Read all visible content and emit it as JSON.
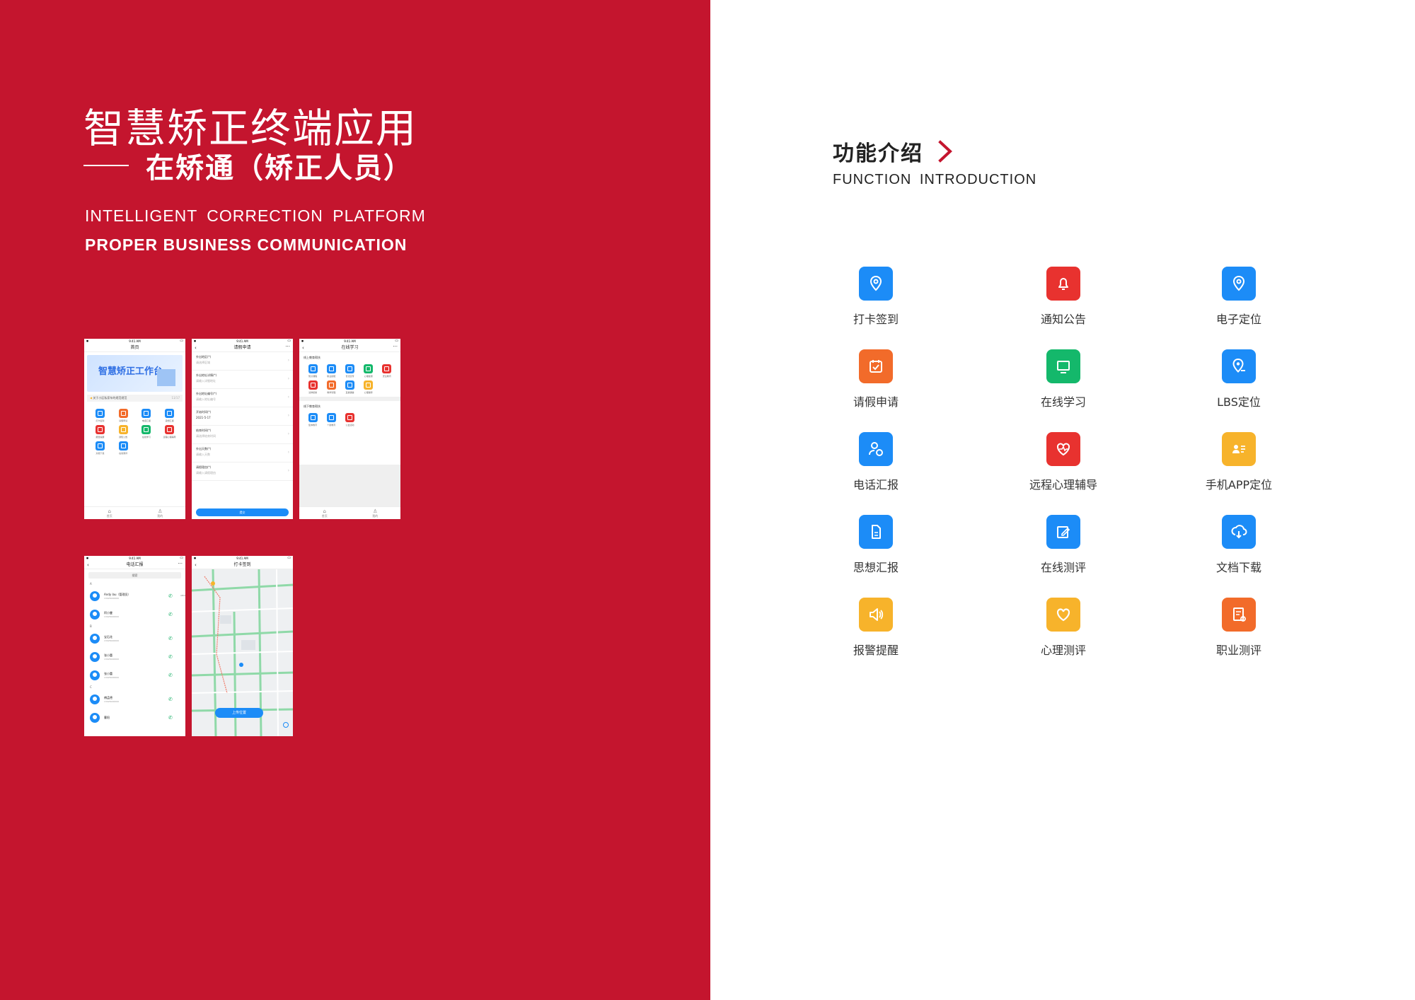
{
  "header": {
    "title_cn": "智慧矫正终端应用",
    "subtitle_cn": "在矫通（矫正人员）",
    "title_en": "INTELLIGENT  CORRECTION  PLATFORM",
    "subtitle_en": "PROPER BUSINESS COMMUNICATION"
  },
  "colors": {
    "brand_red": "#c4152e",
    "blue": "#1c8cf7",
    "red": "#e8322f",
    "orange": "#f26b2a",
    "green": "#14b86b",
    "yellow": "#f7b32b"
  },
  "phones": {
    "home": {
      "status_time": "9:41 AM",
      "title": "首页",
      "banner_text": "智慧矫正工作台",
      "notice": "关于小区私家车的规范规范",
      "notice_date": "11/17",
      "grid": [
        {
          "label": "打卡签到",
          "color": "#1c8cf7"
        },
        {
          "label": "请假申请",
          "color": "#f26b2a"
        },
        {
          "label": "电话汇报",
          "color": "#1c8cf7"
        },
        {
          "label": "思想汇报",
          "color": "#1c8cf7"
        },
        {
          "label": "报警提醒",
          "color": "#e8322f"
        },
        {
          "label": "通知公告",
          "color": "#f7b32b"
        },
        {
          "label": "在线学习",
          "color": "#14b86b"
        },
        {
          "label": "远程心理辅导",
          "color": "#e8322f"
        },
        {
          "label": "文档下载",
          "color": "#1c8cf7"
        },
        {
          "label": "在线测评",
          "color": "#1c8cf7"
        }
      ],
      "tabs": [
        "首页",
        "我的"
      ]
    },
    "leave": {
      "status_time": "9:41 AM",
      "title": "请假申请",
      "fields": [
        {
          "label": "外出地区(*)",
          "value": "请选择区域"
        },
        {
          "label": "外出地址详情(*)",
          "value": "请输入详细地址"
        },
        {
          "label": "外出地址编号(*)",
          "value": "请输入地址编号"
        },
        {
          "label": "开始时间(*)",
          "value": "2021-5-17"
        },
        {
          "label": "结束时间(*)",
          "value": "请选择结束时间"
        },
        {
          "label": "外出天数(*)",
          "value": "请输入天数"
        },
        {
          "label": "请假理由(*)",
          "value": "请输入请假理由"
        }
      ],
      "submit": "提交"
    },
    "study": {
      "status_time": "9:41 AM",
      "title": "在线学习",
      "online_section": "线上教育帮扶",
      "online_items": [
        {
          "label": "知识课程",
          "color": "#1c8cf7"
        },
        {
          "label": "职业技能",
          "color": "#1c8cf7"
        },
        {
          "label": "普法宣传",
          "color": "#1c8cf7"
        },
        {
          "label": "心理健康",
          "color": "#14b86b"
        },
        {
          "label": "安全教育",
          "color": "#e8322f"
        },
        {
          "label": "法律援助",
          "color": "#e8322f"
        },
        {
          "label": "教学管理",
          "color": "#f26b2a"
        },
        {
          "label": "直播课堂",
          "color": "#1c8cf7"
        },
        {
          "label": "心理辅导",
          "color": "#f7b32b"
        }
      ],
      "offline_section": "线下教育帮扶",
      "offline_items": [
        {
          "label": "集体教育",
          "color": "#1c8cf7"
        },
        {
          "label": "个别教育",
          "color": "#1c8cf7"
        },
        {
          "label": "公益活动",
          "color": "#e8322f"
        }
      ],
      "tabs": [
        "首页",
        "我的"
      ]
    },
    "contacts": {
      "status_time": "9:41 AM",
      "title": "电话汇报",
      "search": "搜索",
      "groups": [
        {
          "letter": "A",
          "rows": [
            {
              "name": "Andy lau（管理员）",
              "phone": "13025000000"
            },
            {
              "name": "阿小曼",
              "phone": "13025000000"
            }
          ]
        },
        {
          "letter": "B",
          "rows": [
            {
              "name": "宝石花",
              "phone": "13025000000"
            },
            {
              "name": "张小蕾",
              "phone": "13025000000"
            },
            {
              "name": "张小蕾",
              "phone": "13025000000"
            }
          ]
        },
        {
          "letter": "C",
          "rows": [
            {
              "name": "傅孟德",
              "phone": "13025000000"
            },
            {
              "name": "曹阳",
              "phone": ""
            }
          ]
        }
      ],
      "index_letters": "ABCDEFGHIJKLMNOPQRSTUVWXYZ#"
    },
    "checkin": {
      "status_time": "9:41 AM",
      "title": "打卡签到",
      "upload_button": "上传位置"
    }
  },
  "functions": {
    "title_cn": "功能介绍",
    "title_en": "FUNCTION  INTRODUCTION",
    "items": [
      {
        "label": "打卡签到",
        "icon": "location-pin-icon",
        "color": "#1c8cf7"
      },
      {
        "label": "通知公告",
        "icon": "bell-icon",
        "color": "#e8322f"
      },
      {
        "label": "电子定位",
        "icon": "location-pin-icon",
        "color": "#1c8cf7"
      },
      {
        "label": "请假申请",
        "icon": "calendar-check-icon",
        "color": "#f26b2a"
      },
      {
        "label": "在线学习",
        "icon": "monitor-icon",
        "color": "#14b86b"
      },
      {
        "label": "LBS定位",
        "icon": "location-search-icon",
        "color": "#1c8cf7"
      },
      {
        "label": "电话汇报",
        "icon": "user-phone-icon",
        "color": "#1c8cf7"
      },
      {
        "label": "远程心理辅导",
        "icon": "heart-pulse-icon",
        "color": "#e8322f"
      },
      {
        "label": "手机APP定位",
        "icon": "id-card-icon",
        "color": "#f7b32b"
      },
      {
        "label": "思想汇报",
        "icon": "document-icon",
        "color": "#1c8cf7"
      },
      {
        "label": "在线测评",
        "icon": "edit-icon",
        "color": "#1c8cf7"
      },
      {
        "label": "文档下载",
        "icon": "cloud-download-icon",
        "color": "#1c8cf7"
      },
      {
        "label": "报警提醒",
        "icon": "speaker-icon",
        "color": "#f7b32b"
      },
      {
        "label": "心理测评",
        "icon": "heart-icon",
        "color": "#f7b32b"
      },
      {
        "label": "职业测评",
        "icon": "report-icon",
        "color": "#f26b2a"
      }
    ]
  }
}
